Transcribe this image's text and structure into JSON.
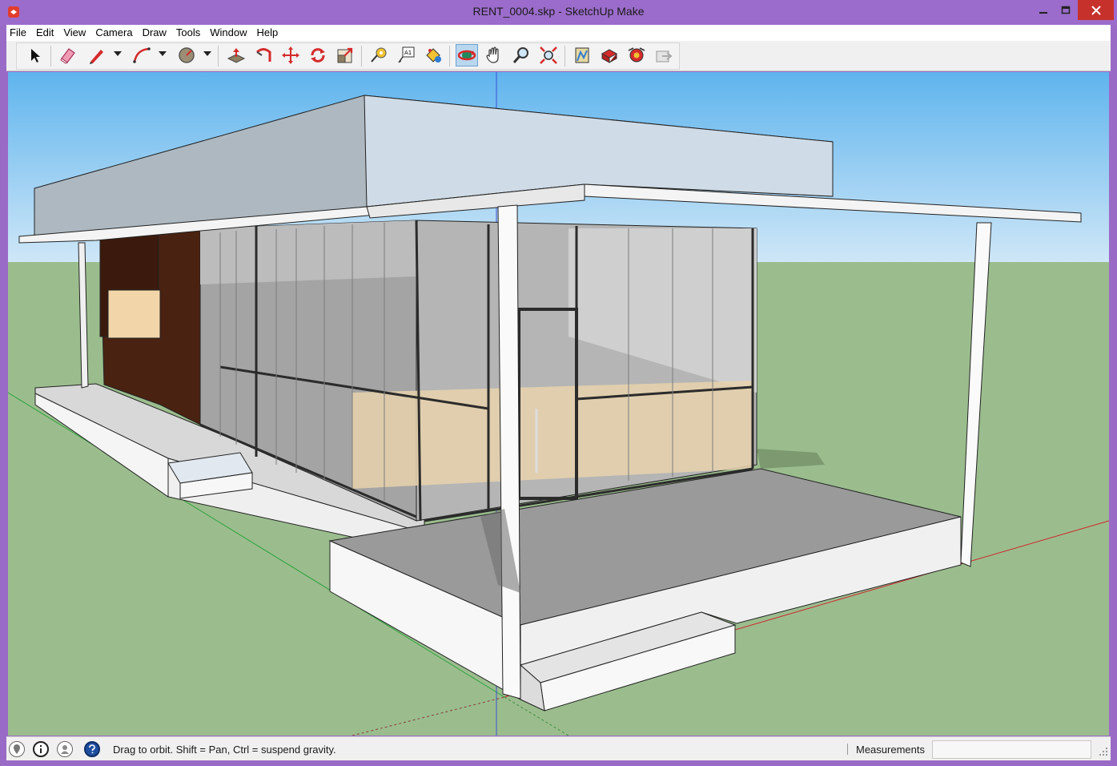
{
  "window": {
    "title": "RENT_0004.skp - SketchUp Make",
    "app_icon": "sketchup-logo-icon"
  },
  "menu": [
    {
      "label": "File"
    },
    {
      "label": "Edit"
    },
    {
      "label": "View"
    },
    {
      "label": "Camera"
    },
    {
      "label": "Draw"
    },
    {
      "label": "Tools"
    },
    {
      "label": "Window"
    },
    {
      "label": "Help"
    }
  ],
  "toolbar": {
    "tools": [
      {
        "name": "select-icon"
      },
      {
        "name": "eraser-icon"
      },
      {
        "name": "pencil-line-icon",
        "has_dropdown": true
      },
      {
        "name": "arc-icon",
        "has_dropdown": true
      },
      {
        "name": "circle-shapes-icon",
        "has_dropdown": true
      },
      {
        "name": "push-pull-icon"
      },
      {
        "name": "follow-me-icon"
      },
      {
        "name": "move-icon"
      },
      {
        "name": "rotate-icon"
      },
      {
        "name": "scale-icon"
      },
      {
        "name": "tape-measure-icon"
      },
      {
        "name": "text-icon",
        "glyph": "A1"
      },
      {
        "name": "paint-bucket-icon"
      },
      {
        "name": "orbit-icon",
        "active": true
      },
      {
        "name": "pan-icon"
      },
      {
        "name": "zoom-icon"
      },
      {
        "name": "zoom-extents-icon"
      },
      {
        "name": "3d-warehouse-icon"
      },
      {
        "name": "extension-warehouse-icon"
      },
      {
        "name": "layout-icon"
      },
      {
        "name": "share-model-icon"
      }
    ]
  },
  "status": {
    "icons": [
      "geo-location-icon",
      "credits-icon",
      "user-account-icon",
      "help-icon"
    ],
    "hint": "Drag to orbit. Shift = Pan, Ctrl = suspend gravity.",
    "measurements_label": "Measurements",
    "measurements_value": ""
  },
  "colors": {
    "titlebar": "#9b6ccb",
    "close_button": "#c7312b",
    "sky_top": "#5fb4ee",
    "sky_bottom": "#cfe7f7",
    "ground": "#9bbd8e",
    "active_tool": "#b9d7ef"
  }
}
